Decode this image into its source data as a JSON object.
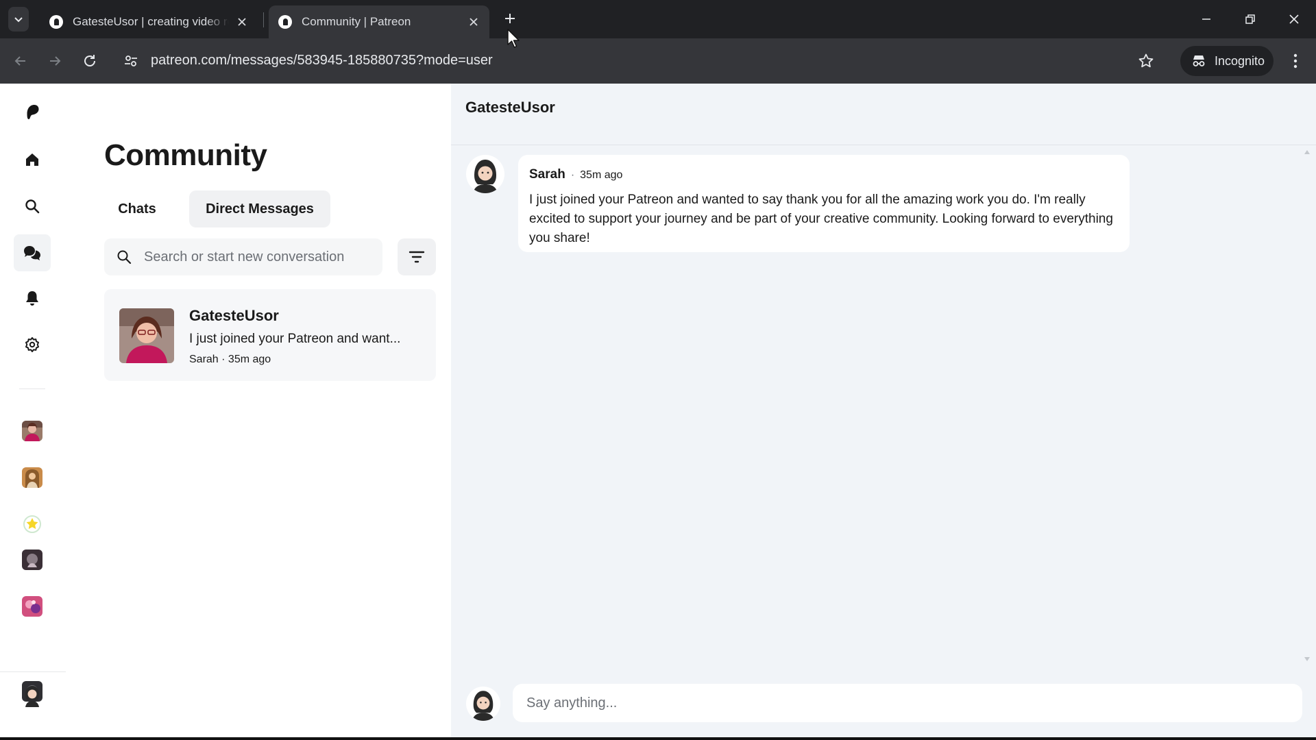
{
  "browser": {
    "tabs": [
      {
        "title": "GatesteUsor | creating video re",
        "active": false
      },
      {
        "title": "Community | Patreon",
        "active": true
      }
    ],
    "address": "patreon.com/messages/583945-185880735?mode=user",
    "incognito_label": "Incognito"
  },
  "rail": {
    "items": [
      {
        "name": "patreon-logo-icon"
      },
      {
        "name": "home-icon"
      },
      {
        "name": "search-icon"
      },
      {
        "name": "chat-bubbles-icon",
        "active": true
      },
      {
        "name": "bell-icon"
      },
      {
        "name": "gear-icon"
      }
    ]
  },
  "community": {
    "title": "Community",
    "tabs": [
      {
        "label": "Chats",
        "active": false
      },
      {
        "label": "Direct Messages",
        "active": true
      }
    ],
    "search_placeholder": "Search or start new conversation",
    "conversations": [
      {
        "name": "GatesteUsor",
        "preview": "I just joined your Patreon and want...",
        "meta": "Sarah · 35m ago"
      }
    ]
  },
  "chat": {
    "title": "GatesteUsor",
    "messages": [
      {
        "author": "Sarah",
        "separator": "·",
        "time": "35m ago",
        "text": "I just joined your Patreon and wanted to say thank you for all the amazing work you do. I'm really excited to support your journey and be part of your creative community. Looking forward to everything you share!"
      }
    ],
    "composer_placeholder": "Say anything..."
  },
  "colors": {
    "chrome_dark": "#202124",
    "chrome_toolbar": "#35363a",
    "chat_background": "#f1f4f8",
    "accent_text": "#1a1a1a"
  }
}
